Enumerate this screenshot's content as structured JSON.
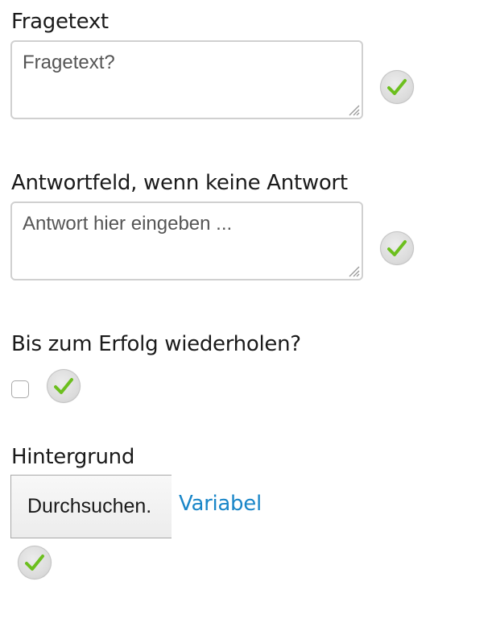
{
  "question": {
    "label": "Fragetext",
    "placeholder": "Fragetext?"
  },
  "no_answer": {
    "label": "Antwortfeld, wenn keine Antwort",
    "placeholder": "Antwort hier eingeben ..."
  },
  "repeat": {
    "label": "Bis zum Erfolg wiederholen?",
    "checked": false
  },
  "background": {
    "label": "Hintergrund",
    "browse_label": "Durchsuchen.",
    "variable_link": "Variabel"
  },
  "colors": {
    "link": "#1a86c8",
    "check": "#7ccc2a"
  },
  "icons": {
    "confirm": "checkmark-icon",
    "resize": "resize-grip-icon"
  }
}
